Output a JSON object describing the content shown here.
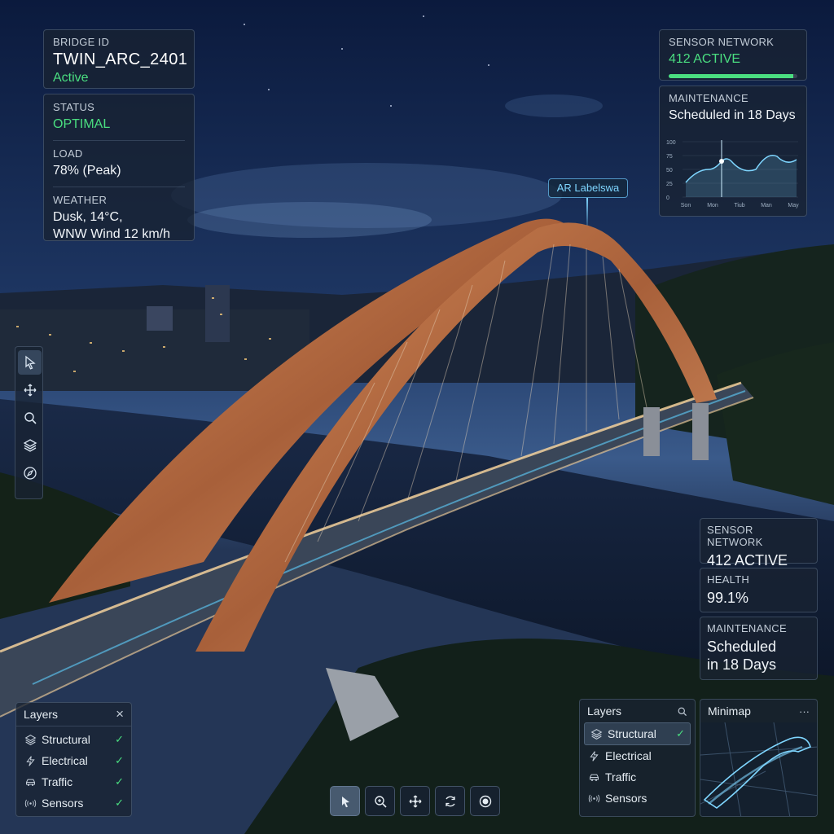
{
  "colors": {
    "accent_green": "#4ade80",
    "ar_blue": "#7fd6ff",
    "arch_copper": "#c27a4e"
  },
  "bridge": {
    "id_label": "BRIDGE ID",
    "id": "TWIN_ARC_2401",
    "state": "Active"
  },
  "status_panel": {
    "status_label": "STATUS",
    "status_value": "OPTIMAL",
    "load_label": "LOAD",
    "load_value": "78% (Peak)",
    "weather_label": "WEATHER",
    "weather_line1": "Dusk, 14°C,",
    "weather_line2": "WNW Wind 12 km/h"
  },
  "sensor_top": {
    "label": "SENSOR NETWORK",
    "value": "412 ACTIVE",
    "progress": 0.97
  },
  "maintenance_top": {
    "label": "MAINTENANCE",
    "value": "Scheduled in 18 Days",
    "chart_y_ticks": [
      "100",
      "75",
      "50",
      "25",
      "0"
    ],
    "chart_x_ticks": [
      "Son",
      "Mon",
      "Tiub",
      "Man",
      "May"
    ]
  },
  "ar_label": "AR Labelswa",
  "left_toolbar": {
    "tools": [
      "cursor-icon",
      "move-icon",
      "search-icon",
      "layers-icon",
      "compass-icon"
    ]
  },
  "right_stack": {
    "sensor_label": "SENSOR NETWORK",
    "sensor_value": "412 ACTIVE",
    "health_label": "HEALTH",
    "health_value": "99.1%",
    "maint_label": "MAINTENANCE",
    "maint_line1": "Scheduled",
    "maint_line2": "in 18 Days"
  },
  "layers_left": {
    "title": "Layers",
    "close": "×",
    "items": [
      {
        "label": "Structural",
        "icon": "layers-icon"
      },
      {
        "label": "Electrical",
        "icon": "lightning-icon"
      },
      {
        "label": "Traffic",
        "icon": "car-icon"
      },
      {
        "label": "Sensors",
        "icon": "signal-icon"
      }
    ],
    "check": "✓"
  },
  "layers_right": {
    "title": "Layers",
    "items": [
      {
        "label": "Structural",
        "icon": "layers-icon"
      },
      {
        "label": "Electrical",
        "icon": "lightning-icon"
      },
      {
        "label": "Traffic",
        "icon": "car-icon"
      },
      {
        "label": "Sensors",
        "icon": "signal-icon"
      }
    ],
    "check": "✓"
  },
  "minimap": {
    "title": "Minimap",
    "menu": "···"
  },
  "bottom_toolbar": {
    "tools": [
      "select-icon",
      "zoom-icon",
      "pan-icon",
      "rotate-icon",
      "record-icon"
    ]
  }
}
